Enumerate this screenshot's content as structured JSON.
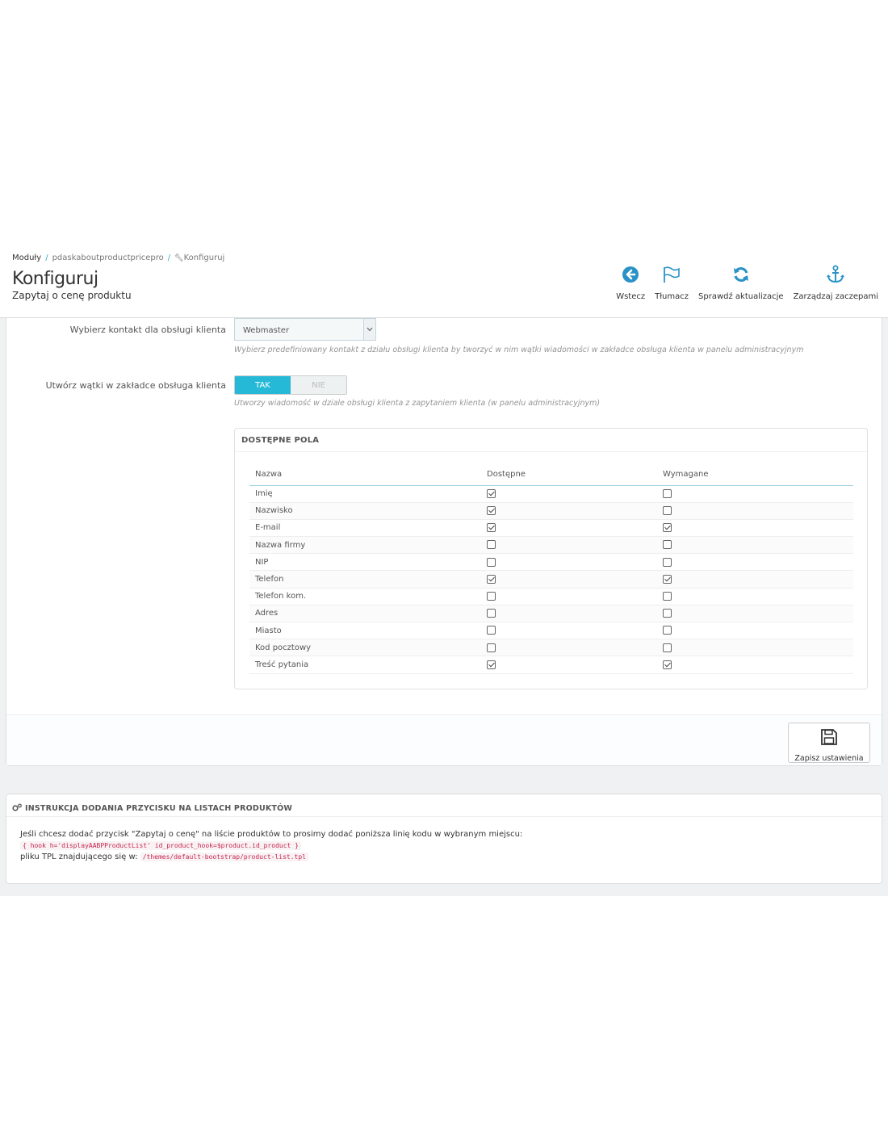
{
  "breadcrumb": {
    "items": [
      "Moduły",
      "pdaskaboutproductpricepro",
      "Konfiguruj"
    ]
  },
  "header": {
    "title": "Konfiguruj",
    "subtitle": "Zapytaj o cenę produktu"
  },
  "toolbar": {
    "back": "Wstecz",
    "translate": "Tłumacz",
    "check_updates": "Sprawdź aktualizacje",
    "manage_hooks": "Zarządzaj zaczepami"
  },
  "form": {
    "contact_label": "Wybierz kontakt dla obsługi klienta",
    "contact_value": "Webmaster",
    "contact_help": "Wybierz predefiniowany kontakt z działu obsługi klienta by tworzyć w nim wątki wiadomości w zakładce obsługa klienta w panelu administracyjnym",
    "threads_label": "Utwórz wątki w zakładce obsługa klienta",
    "switch_on": "TAK",
    "switch_off": "NIE",
    "threads_help": "Utworzy wiadomość w dziale obsługi klienta z zapytaniem klienta (w panelu administracyjnym)"
  },
  "fields_panel": {
    "title": "DOSTĘPNE POLA",
    "columns": [
      "Nazwa",
      "Dostępne",
      "Wymagane"
    ],
    "rows": [
      {
        "name": "Imię",
        "available": true,
        "required": false
      },
      {
        "name": "Nazwisko",
        "available": true,
        "required": false
      },
      {
        "name": "E-mail",
        "available": true,
        "required": true
      },
      {
        "name": "Nazwa firmy",
        "available": false,
        "required": false
      },
      {
        "name": "NIP",
        "available": false,
        "required": false
      },
      {
        "name": "Telefon",
        "available": true,
        "required": true
      },
      {
        "name": "Telefon kom.",
        "available": false,
        "required": false
      },
      {
        "name": "Adres",
        "available": false,
        "required": false
      },
      {
        "name": "Miasto",
        "available": false,
        "required": false
      },
      {
        "name": "Kod pocztowy",
        "available": false,
        "required": false
      },
      {
        "name": "Treść pytania",
        "available": true,
        "required": true
      }
    ]
  },
  "footer": {
    "save_label": "Zapisz ustawienia"
  },
  "instructions": {
    "title": "INSTRUKCJA DODANIA PRZYCISKU NA LISTACH PRODUKTÓW",
    "line1": "Jeśli chcesz dodać przycisk \"Zapytaj o cenę\" na liście produktów to prosimy dodać poniższa linię kodu w wybranym miejscu:",
    "code1": "{ hook h='displayAABPProductList' id_product_hook=$product.id_product }",
    "line2": "pliku TPL znajdującego się w:",
    "code2": "/themes/default-bootstrap/product-list.tpl"
  },
  "colors": {
    "accent": "#25b9d7",
    "code_text": "#c7254e"
  }
}
